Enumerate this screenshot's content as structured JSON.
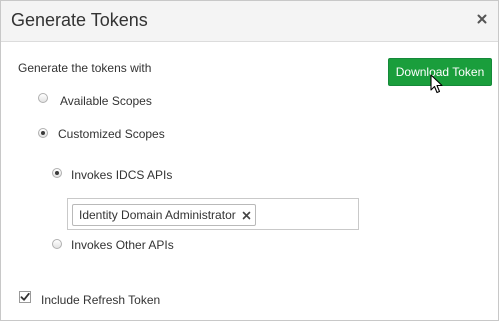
{
  "dialog": {
    "title": "Generate Tokens"
  },
  "form": {
    "section_label": "Generate the tokens with",
    "download_button": "Download Token",
    "scope_options": {
      "available": "Available Scopes",
      "customized": "Customized Scopes"
    },
    "selected_scope": "Customized Scopes",
    "api_options": {
      "idcs": "Invokes IDCS APIs",
      "other": "Invokes Other APIs"
    },
    "selected_api": "Invokes IDCS APIs",
    "selected_roles": [
      "Identity Domain Administrator"
    ],
    "include_refresh_token": {
      "label": "Include Refresh Token",
      "checked": true
    }
  },
  "colors": {
    "accent_button": "#1a9e3c",
    "header_background": "#f4f4f4"
  }
}
